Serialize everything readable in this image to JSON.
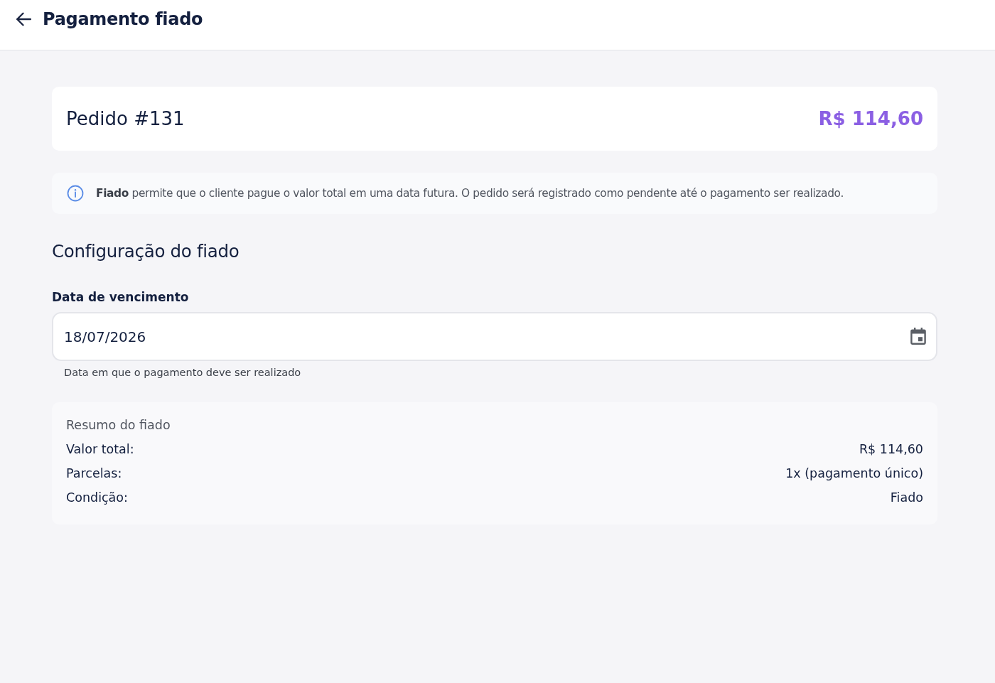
{
  "header": {
    "title": "Pagamento fiado"
  },
  "order": {
    "title": "Pedido #131",
    "amount": "R$ 114,60"
  },
  "info": {
    "text": "**Fiado** permite que o cliente pague o valor total em uma data futura. O pedido será registrado como pendente até o pagamento ser realizado."
  },
  "section": {
    "title": "Configuração do fiado"
  },
  "due_date": {
    "label": "Data de vencimento",
    "value": "18/07/2026",
    "helper": "Data em que o pagamento deve ser realizado"
  },
  "summary": {
    "title": "Resumo do fiado",
    "rows": [
      {
        "label": "Valor total:",
        "value": "R$ 114,60"
      },
      {
        "label": "Parcelas:",
        "value": "1x (pagamento único)"
      },
      {
        "label": "Condição:",
        "value": "Fiado"
      }
    ]
  }
}
